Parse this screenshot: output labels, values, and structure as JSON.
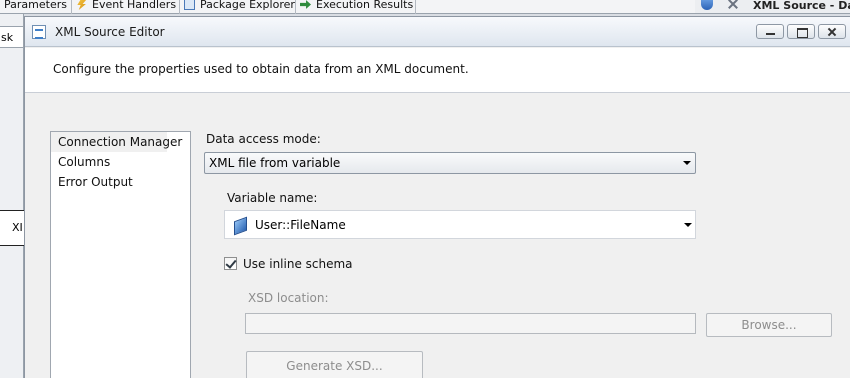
{
  "background": {
    "tabs": [
      {
        "label": "Parameters",
        "icon": "parameters-icon"
      },
      {
        "label": "Event Handlers",
        "icon": "bolt-icon"
      },
      {
        "label": "Package Explorer",
        "icon": "package-icon"
      },
      {
        "label": "Execution Results",
        "icon": "green-arrow-icon"
      }
    ],
    "right_label": "XML Source - Dat",
    "left_tab_top": "sk",
    "left_tab_mid": "XI"
  },
  "dialog": {
    "title": "XML Source Editor",
    "description": "Configure the properties used to obtain data from an XML document.",
    "nav_items": [
      {
        "label": "Connection Manager",
        "selected": true
      },
      {
        "label": "Columns",
        "selected": false
      },
      {
        "label": "Error Output",
        "selected": false
      }
    ],
    "access_mode": {
      "label": "Data access mode:",
      "value": "XML file from variable"
    },
    "variable": {
      "label": "Variable name:",
      "value": "User::FileName"
    },
    "inline_schema": {
      "label": "Use inline schema",
      "checked": true
    },
    "xsd_location": {
      "label": "XSD location:",
      "value": ""
    },
    "browse_label": "Browse...",
    "generate_label": "Generate XSD..."
  }
}
